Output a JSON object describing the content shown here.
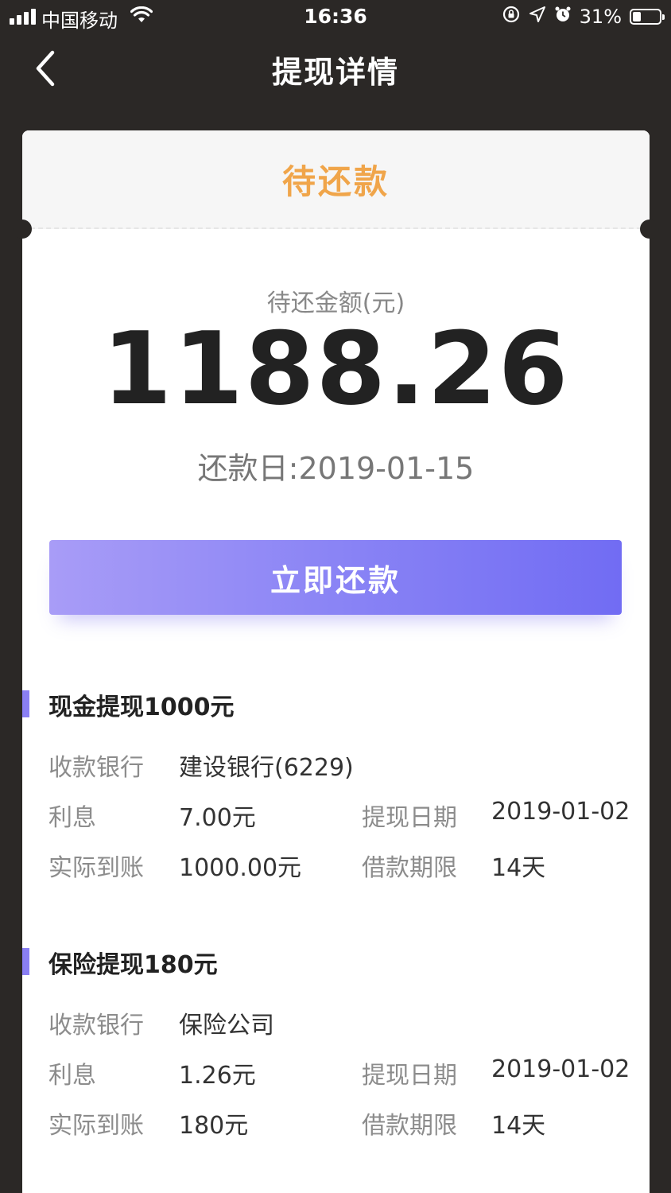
{
  "status_bar": {
    "carrier": "中国移动",
    "time": "16:36",
    "battery": "31%",
    "battery_level": 0.31
  },
  "nav": {
    "title": "提现详情"
  },
  "card": {
    "status": "待还款",
    "amount_caption": "待还金额(元)",
    "amount": "1188.26",
    "due_date": "还款日:2019-01-15",
    "repay_button": "立即还款"
  },
  "sections": [
    {
      "title": "现金提现1000元",
      "bank_label": "收款银行",
      "bank_value": "建设银行(6229)",
      "interest_label": "利息",
      "interest_value": "7.00元",
      "date_label": "提现日期",
      "date_value": "2019-01-02",
      "received_label": "实际到账",
      "received_value": "1000.00元",
      "term_label": "借款期限",
      "term_value": "14天"
    },
    {
      "title": "保险提现180元",
      "bank_label": "收款银行",
      "bank_value": "保险公司",
      "interest_label": "利息",
      "interest_value": "1.26元",
      "date_label": "提现日期",
      "date_value": "2019-01-02",
      "received_label": "实际到账",
      "received_value": "180元",
      "term_label": "借款期限",
      "term_value": "14天"
    }
  ],
  "colors": {
    "background": "#2b2826",
    "status_orange": "#f0a54a",
    "accent_purple": "#8a7ff4"
  }
}
